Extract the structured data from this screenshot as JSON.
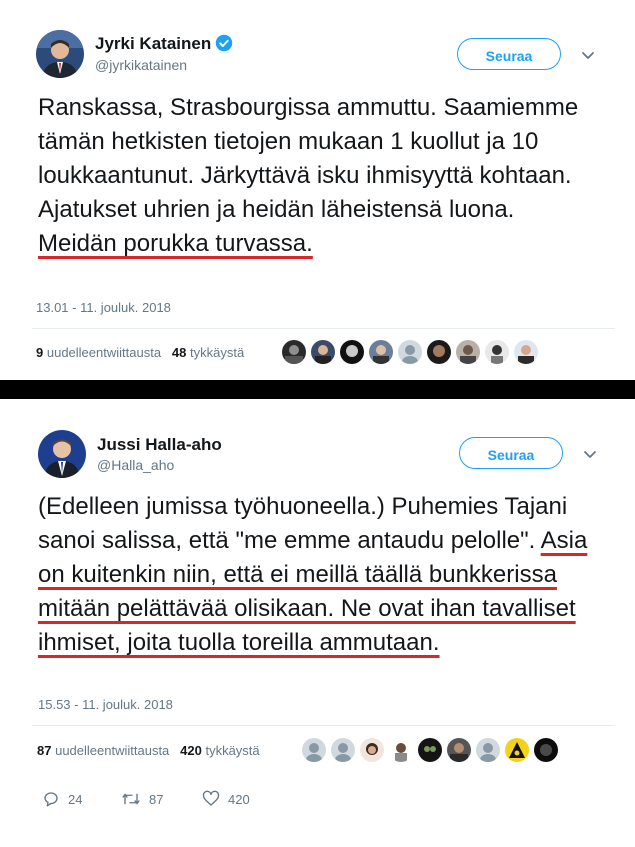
{
  "tweet1": {
    "author_name": "Jyrki Katainen",
    "author_handle": "@jyrkikatainen",
    "follow_label": "Seuraa",
    "text_plain": "Ranskassa, Strasbourgissa ammuttu. Saamiemme tämän hetkisten tietojen mukaan 1 kuollut ja 10 loukkaantunut. Järkyttävä isku ihmisyyttä kohtaan. Ajatukset uhrien ja heidän läheistensä luona. ",
    "text_underlined": "Meidän porukka turvassa.",
    "timestamp": "13.01 - 11. jouluk. 2018",
    "retweets_count": "9",
    "retweets_label": "uudelleentwiittausta",
    "likes_count": "48",
    "likes_label": "tykkäystä"
  },
  "tweet2": {
    "author_name": "Jussi Halla-aho",
    "author_handle": "@Halla_aho",
    "follow_label": "Seuraa",
    "text_plain": "(Edelleen jumissa työhuoneella.) Puhemies Tajani sanoi salissa, että \"me emme antaudu pelolle\". ",
    "text_underlined": "Asia on kuitenkin niin, että ei meillä täällä bunkkerissa mitään pelättävää olisikaan. Ne ovat ihan tavalliset ihmiset, joita tuolla toreilla ammutaan.",
    "timestamp": "15.53 - 11. jouluk. 2018",
    "retweets_count": "87",
    "retweets_label": "uudelleentwiittausta",
    "likes_count": "420",
    "likes_label": "tykkäystä",
    "reply_count": "24",
    "retweet_action_count": "87",
    "like_action_count": "420"
  },
  "colors": {
    "accent": "#1da1f2",
    "underline": "#d62828",
    "muted": "#657786",
    "text": "#14171a"
  }
}
